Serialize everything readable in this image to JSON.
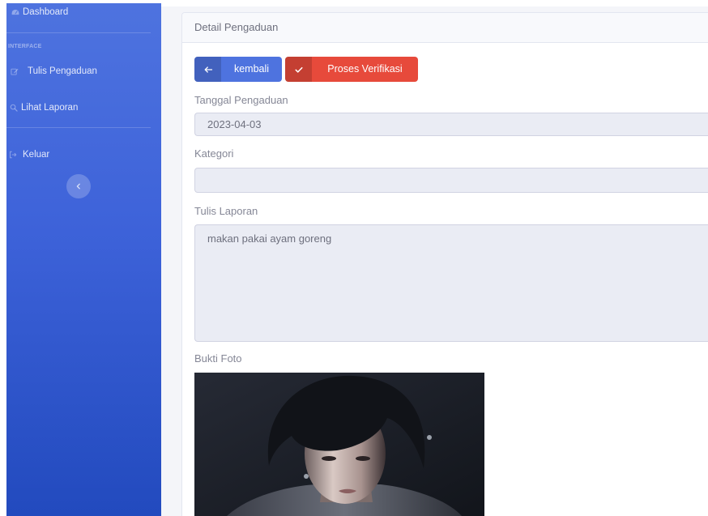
{
  "theme": {
    "sidebar_top": "#4e73df",
    "sidebar_bottom": "#224abe",
    "primary": "#4e73df",
    "danger": "#e74a3b",
    "input_bg": "#eaecf4"
  },
  "sidebar": {
    "dashboard": {
      "label": "Dashboard",
      "icon": "tachometer-icon"
    },
    "section_heading": "INTERFACE",
    "items": [
      {
        "label": "Tulis Pengaduan",
        "icon": "edit-icon"
      },
      {
        "label": "Lihat Laporan",
        "icon": "search-icon"
      }
    ],
    "logout": {
      "label": "Keluar",
      "icon": "sign-out-icon"
    },
    "toggle": {
      "icon": "chevron-left-icon"
    }
  },
  "card": {
    "title": "Detail Pengaduan"
  },
  "actions": {
    "back": {
      "label": "kembali",
      "icon": "arrow-left-icon"
    },
    "verify": {
      "label": "Proses Verifikasi",
      "icon": "check-icon"
    }
  },
  "form": {
    "date": {
      "label": "Tanggal Pengaduan",
      "value": "2023-04-03"
    },
    "category": {
      "label": "Kategori",
      "value": ""
    },
    "report": {
      "label": "Tulis Laporan",
      "value": "makan pakai ayam goreng"
    },
    "photo": {
      "label": "Bukti Foto"
    }
  }
}
